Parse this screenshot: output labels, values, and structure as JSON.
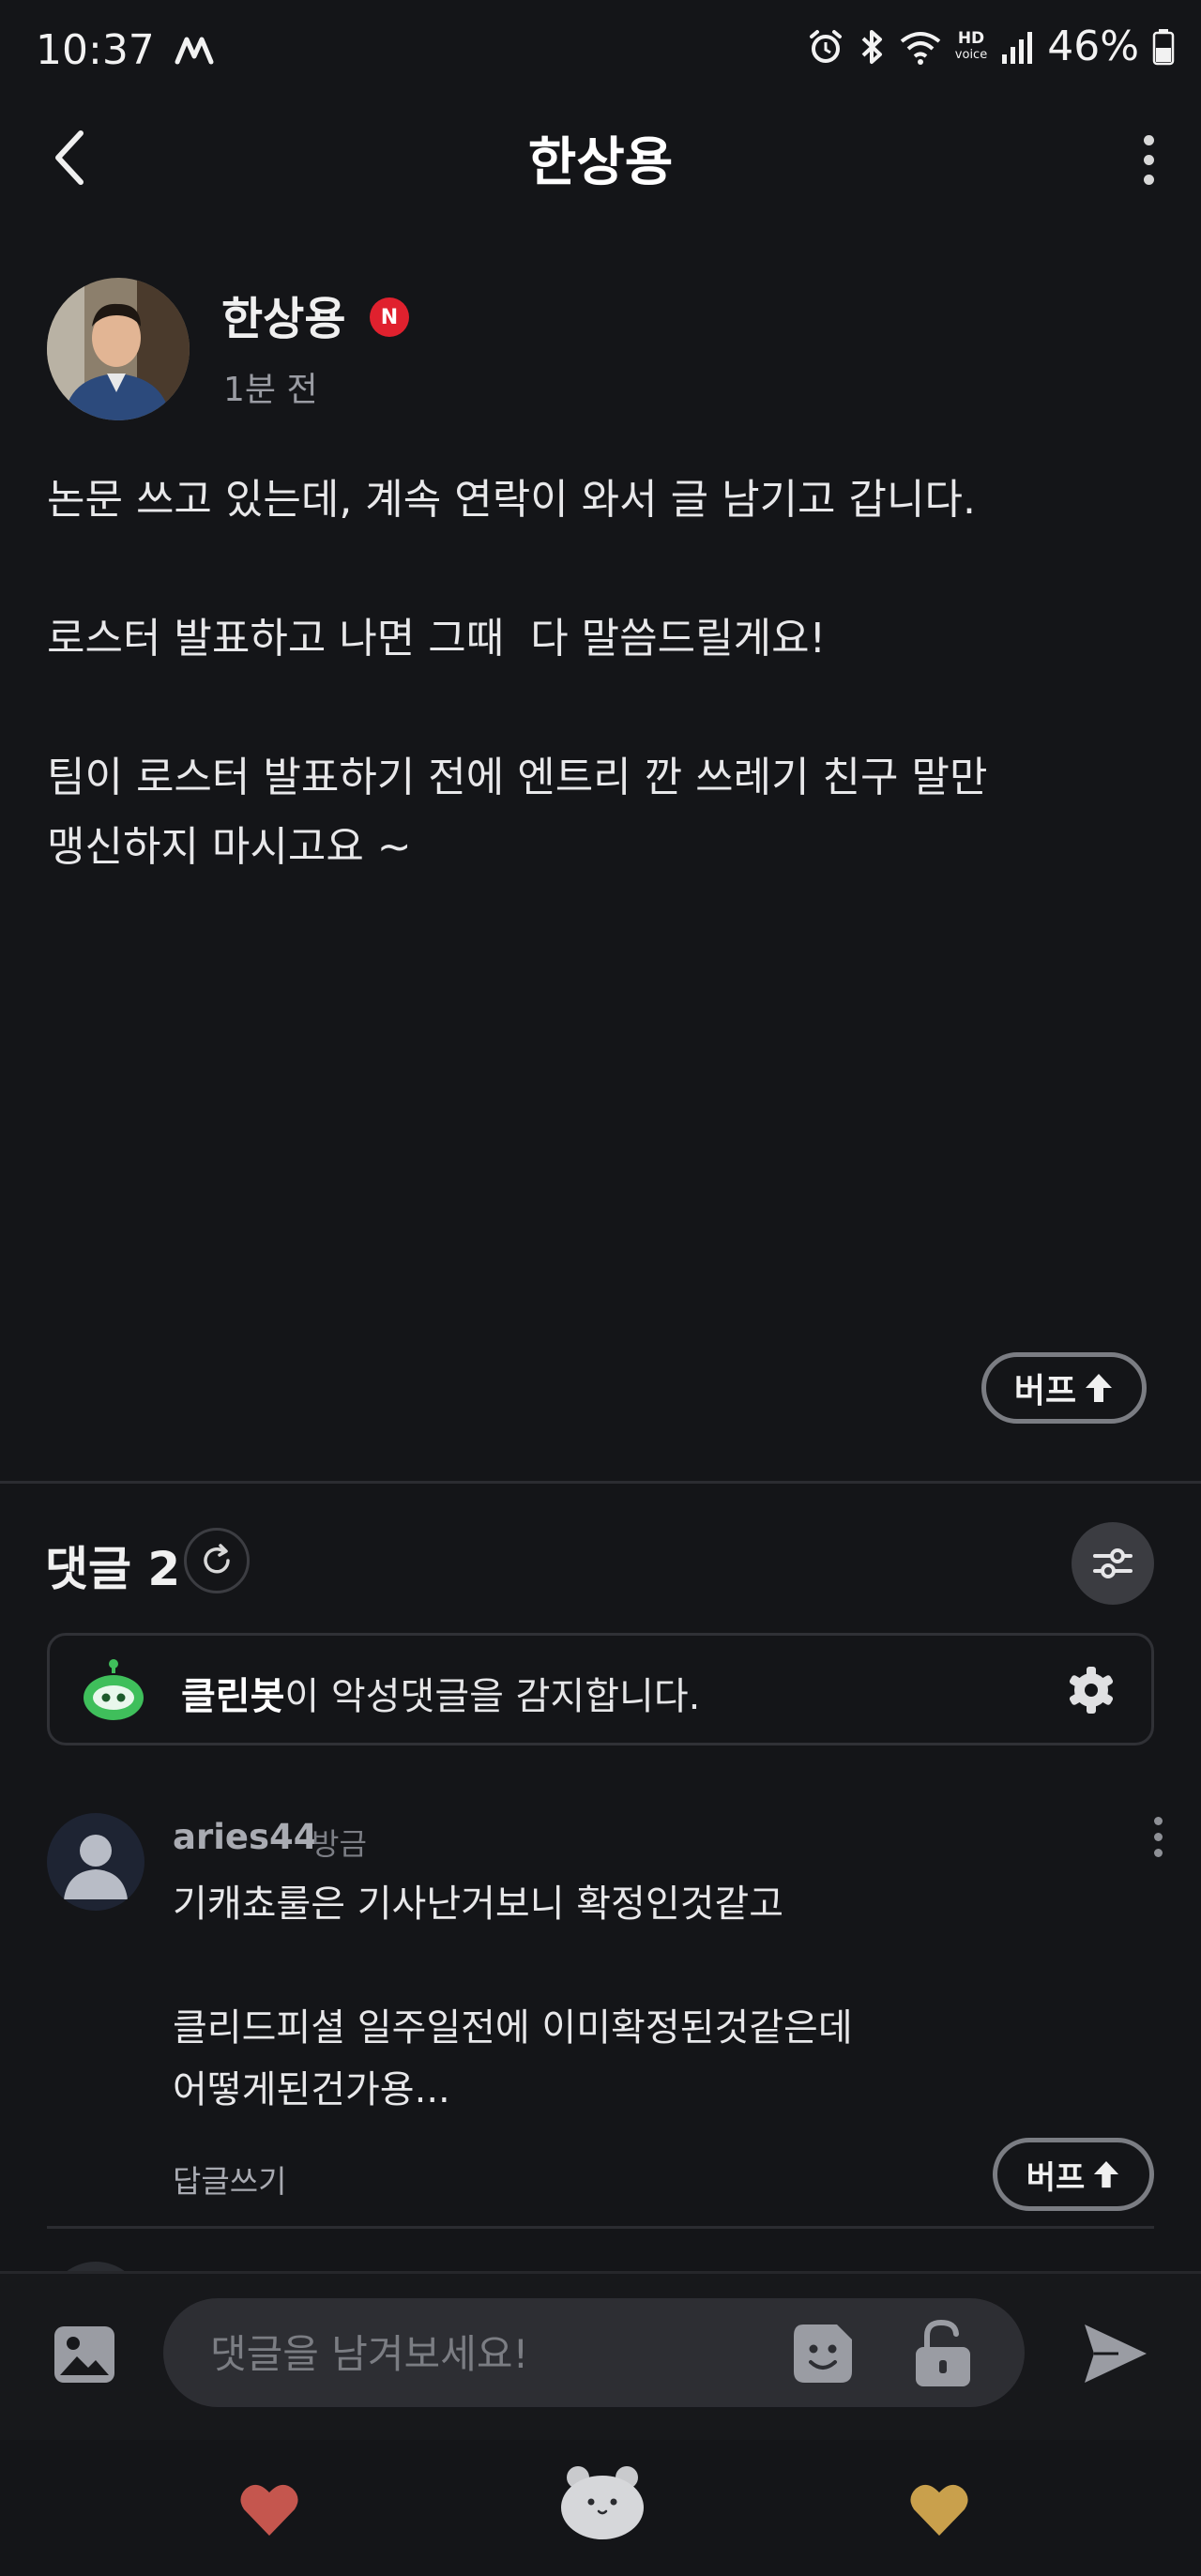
{
  "status_bar": {
    "time": "10:37",
    "battery": "46%",
    "hd": "HD",
    "voice": "voice"
  },
  "header": {
    "title": "한상용"
  },
  "post": {
    "author": "한상용",
    "badge": "N",
    "time": "1분 전",
    "body": "논문 쓰고 있는데, 계속 연락이 와서 글 남기고 갑니다.\n\n로스터 발표하고 나면 그때  다 말씀드릴게요!\n\n팀이 로스터 발표하기 전에 엔트리 깐 쓰레기 친구 말만\n맹신하지 마시고요 ~",
    "buff_label": "버프"
  },
  "comments": {
    "label": "댓글 2",
    "cleanbot": {
      "name": "클린봇",
      "text": "이 악성댓글을 감지합니다."
    },
    "items": [
      {
        "user": "aries44",
        "time": "방금",
        "body": "기캐쵸룰은 기사난거보니 확정인것같고\n\n클리드피셜 일주일전에 이미확정된것같은데\n어떻게된건가용...",
        "reply_label": "답글쓰기",
        "buff_label": "버프"
      }
    ]
  },
  "input": {
    "placeholder": "댓글을 남겨보세요!"
  },
  "colors": {
    "background": "#141518",
    "badge_red": "#e0212e",
    "heart_red": "#c5564e",
    "heart_gold": "#c9a04c",
    "bot_green": "#3fbf5b"
  },
  "icons": {
    "status": [
      "m-logo-icon",
      "alarm-icon",
      "bluetooth-icon",
      "wifi-icon",
      "signal-icon",
      "battery-icon"
    ],
    "actions": [
      "back-arrow-icon",
      "more-vertical-icon",
      "refresh-icon",
      "filter-sliders-icon",
      "cleanbot-robot-icon",
      "gear-icon",
      "image-icon",
      "emoji-sticker-icon",
      "lock-open-icon",
      "send-icon",
      "heart-red-icon",
      "bear-icon",
      "heart-gold-icon"
    ]
  }
}
